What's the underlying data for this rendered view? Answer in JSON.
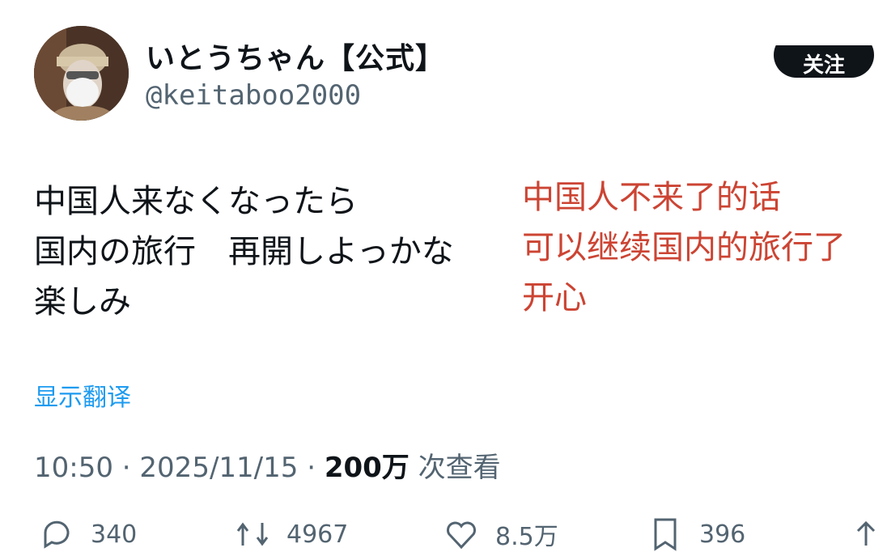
{
  "user": {
    "display_name": "いとうちゃん【公式】",
    "handle": "@keitaboo2000"
  },
  "follow_button": {
    "label": "关注"
  },
  "tweet": {
    "lines": [
      "中国人来なくなったら",
      "国内の旅行　再開しよっかな",
      "楽しみ"
    ],
    "translation_lines": [
      "中国人不来了的话",
      "可以继续国内的旅行了",
      "开心"
    ],
    "show_translation_label": "显示翻译"
  },
  "meta": {
    "time": "10:50",
    "separator": "·",
    "date": "2025/11/15",
    "views_count": "200万",
    "views_label": "次查看"
  },
  "actions": {
    "reply_count": "340",
    "retweet_count": "4967",
    "like_count": "8.5万",
    "bookmark_count": "396"
  },
  "icons": {
    "reply": "reply-icon",
    "retweet": "retweet-icon",
    "like": "heart-icon",
    "bookmark": "bookmark-icon",
    "share": "share-icon"
  },
  "colors": {
    "text": "#0f1419",
    "secondary": "#536471",
    "link": "#1d9bf0",
    "annotation": "#cc4433"
  }
}
